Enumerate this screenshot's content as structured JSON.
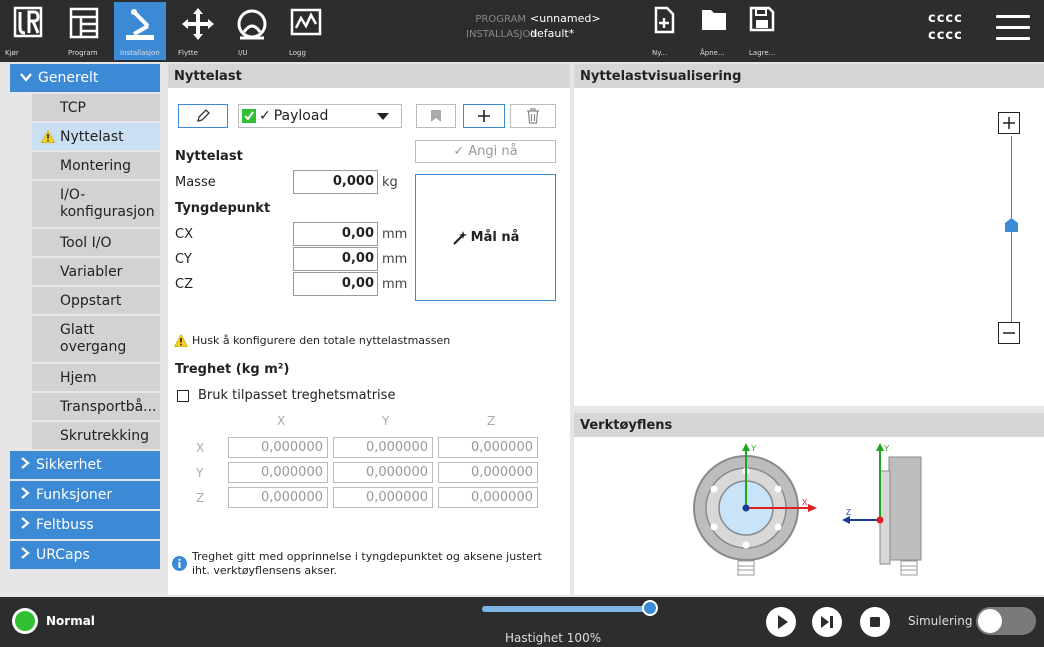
{
  "topbar": {
    "nav": [
      {
        "label": "Kjør"
      },
      {
        "label": "Program"
      },
      {
        "label": "Installasjon"
      },
      {
        "label": "Flytte"
      },
      {
        "label": "I/U"
      },
      {
        "label": "Logg"
      }
    ],
    "program_key": "PROGRAM",
    "program_val": "<unnamed>",
    "install_key": "INSTALLASJON",
    "install_val": "default*",
    "file": [
      {
        "label": "Ny..."
      },
      {
        "label": "Åpne..."
      },
      {
        "label": "Lagre..."
      }
    ],
    "user_line1": "cccc",
    "user_line2": "cccc"
  },
  "sidebar": {
    "general": "Generelt",
    "items": [
      {
        "label": "TCP"
      },
      {
        "label": "Nyttelast"
      },
      {
        "label": "Montering"
      },
      {
        "label": "I/O-\nkonfigurasjon"
      },
      {
        "label": "Tool I/O"
      },
      {
        "label": "Variabler"
      },
      {
        "label": "Oppstart"
      },
      {
        "label": "Glatt\novergang"
      },
      {
        "label": "Hjem"
      },
      {
        "label": "Transportbå..."
      },
      {
        "label": "Skrutrekking"
      }
    ],
    "sections": [
      {
        "label": "Sikkerhet"
      },
      {
        "label": "Funksjoner"
      },
      {
        "label": "Feltbuss"
      },
      {
        "label": "URCaps"
      }
    ]
  },
  "payload": {
    "title": "Nyttelast",
    "selected": "Payload",
    "set_now": "Angi nå",
    "section": "Nyttelast",
    "mass_label": "Masse",
    "mass_value": "0,000",
    "mass_unit": "kg",
    "cog_label": "Tyngdepunkt",
    "cx_label": "CX",
    "cx_value": "0,00",
    "cy_label": "CY",
    "cy_value": "0,00",
    "cz_label": "CZ",
    "cz_value": "0,00",
    "len_unit": "mm",
    "measure": "Mål nå",
    "warning": "Husk å konfigurere den totale nyttelastmassen",
    "inertia_title": "Treghet (kg m²)",
    "custom_matrix": "Bruk tilpasset treghetsmatrise",
    "axes": [
      "X",
      "Y",
      "Z"
    ],
    "matrix": [
      [
        "0,000000",
        "0,000000",
        "0,000000"
      ],
      [
        "0,000000",
        "0,000000",
        "0,000000"
      ],
      [
        "0,000000",
        "0,000000",
        "0,000000"
      ]
    ],
    "info": "Treghet gitt med opprinnelse i tyngdepunktet og aksene justert iht. verktøyflensens akser."
  },
  "viz": {
    "title": "Nyttelastvisualisering"
  },
  "flange": {
    "title": "Verktøyflens",
    "x": "X",
    "y": "Y",
    "z": "Z"
  },
  "bottombar": {
    "status": "Normal",
    "speed": "Hastighet 100%",
    "speed_fraction": 1.0,
    "sim": "Simulering"
  },
  "colors": {
    "accent": "#3c8ad6",
    "dark": "#2b2d2f",
    "warning": "#f4d21f",
    "ok": "#31c031"
  }
}
